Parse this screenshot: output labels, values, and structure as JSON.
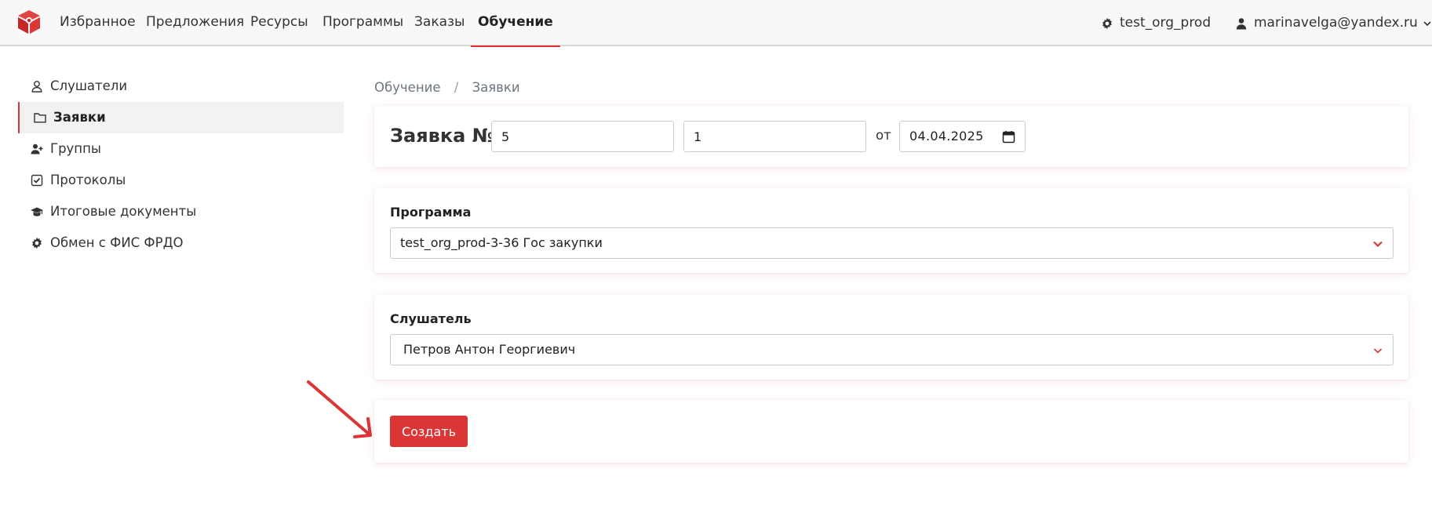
{
  "nav": {
    "items": [
      {
        "label": "Избранное"
      },
      {
        "label": "Предложения"
      },
      {
        "label": "Ресурсы"
      },
      {
        "label": "Программы"
      },
      {
        "label": "Заказы"
      },
      {
        "label": "Обучение"
      }
    ],
    "org": "test_org_prod",
    "user": "marinavelga@yandex.ru"
  },
  "sidebar": {
    "items": [
      {
        "label": "Слушатели",
        "icon": "user-icon"
      },
      {
        "label": "Заявки",
        "icon": "folder-icon"
      },
      {
        "label": "Группы",
        "icon": "user-plus-icon"
      },
      {
        "label": "Протоколы",
        "icon": "check-square-icon"
      },
      {
        "label": "Итоговые документы",
        "icon": "graduation-cap-icon"
      },
      {
        "label": "Обмен с ФИС ФРДО",
        "icon": "gear-icon"
      }
    ]
  },
  "breadcrumb": {
    "parent": "Обучение",
    "separator": "/",
    "current": "Заявки"
  },
  "application": {
    "title": "Заявка №",
    "number_1": "5",
    "number_2": "1",
    "date_prefix": "от",
    "date": "04.04.2025"
  },
  "program": {
    "label": "Программа",
    "value": "test_org_prod-3-36 Гос закупки"
  },
  "listener": {
    "label": "Слушатель",
    "value": "Петров Антон Георгиевич"
  },
  "actions": {
    "create_label": "Создать"
  },
  "colors": {
    "accent": "#dc3535",
    "navbar_bg": "#f8f8f8"
  }
}
